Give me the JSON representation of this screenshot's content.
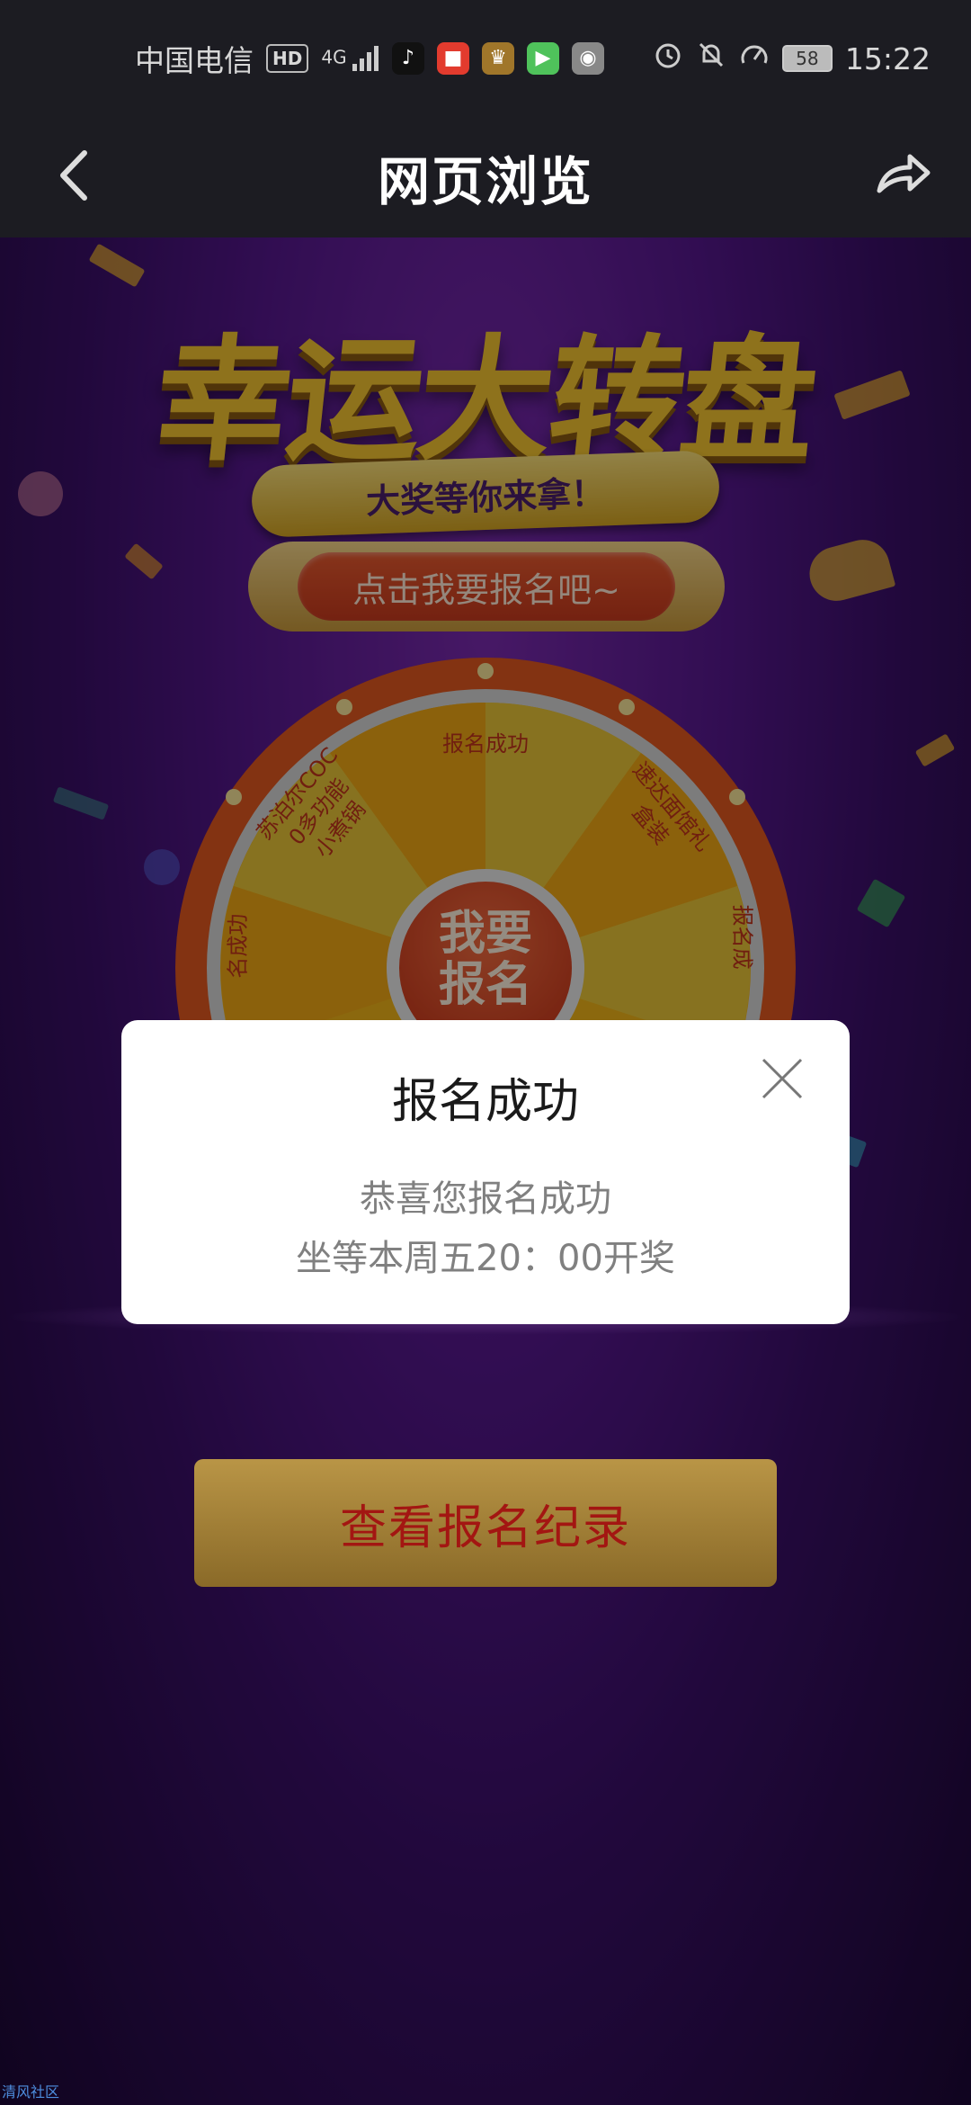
{
  "status_bar": {
    "carrier": "中国电信",
    "hd_badge": "HD",
    "network": "4G",
    "app_icons": [
      "tiktok-icon",
      "news-app-icon",
      "game-app-icon",
      "video-app-icon",
      "camera-app-icon"
    ],
    "battery": "58",
    "time": "15:22"
  },
  "app_bar": {
    "title": "网页浏览"
  },
  "banner": {
    "title": "幸运大转盘",
    "subtitle": "大奖等你来拿！"
  },
  "signup_button": {
    "label": "点击我要报名吧~"
  },
  "wheel": {
    "segments": [
      {
        "label": "报名成功"
      },
      {
        "label": "速达面馆礼\n盒装"
      },
      {
        "label": "报名成"
      },
      {
        "label": "名成功"
      },
      {
        "label": "苏泊尔COC\n0多功能\n小煮锅"
      }
    ],
    "center_label": "我要\n报名"
  },
  "records_button": {
    "label": "查看报名纪录"
  },
  "modal": {
    "title": "报名成功",
    "message_line1": "恭喜您报名成功",
    "message_line2": "坐等本周五20：00开奖"
  },
  "watermark": "清风社区",
  "colors": {
    "status_bar_bg": "#1c1c22",
    "page_purple": "#56188e",
    "accent_gold": "#f5c531",
    "accent_red": "#c83a1d"
  }
}
